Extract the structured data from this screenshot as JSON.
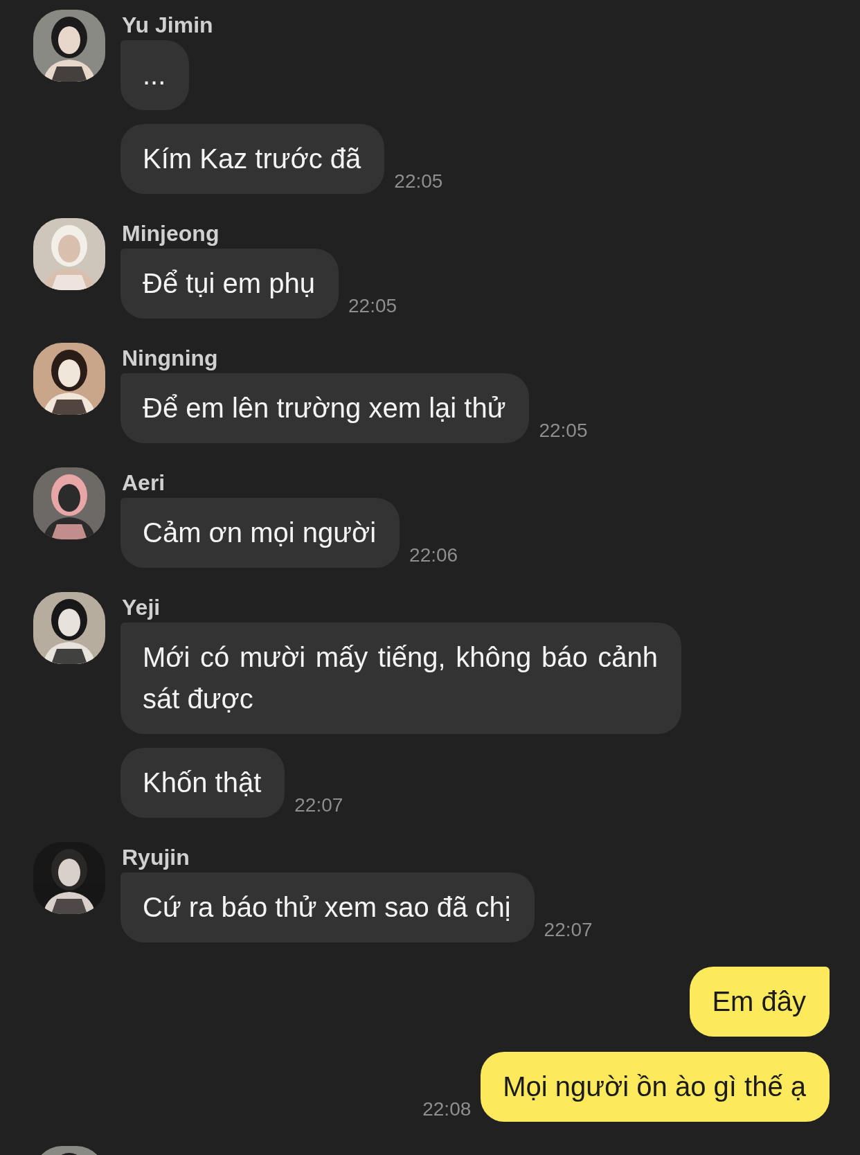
{
  "thread": [
    {
      "kind": "incoming",
      "avatar": {
        "kind": "picture"
      },
      "sender": "Yu Jimin",
      "messages": [
        {
          "text": "..."
        },
        {
          "text": "Kím Kaz trước đã",
          "time": "22:05"
        }
      ]
    },
    {
      "kind": "incoming",
      "avatar": {
        "kind": "picture"
      },
      "sender": "Minjeong",
      "messages": [
        {
          "text": "Để tụi em phụ",
          "time": "22:05"
        }
      ]
    },
    {
      "kind": "incoming",
      "avatar": {
        "kind": "picture"
      },
      "sender": "Ningning",
      "messages": [
        {
          "text": "Để em lên trường xem lại thử",
          "time": "22:05"
        }
      ]
    },
    {
      "kind": "incoming",
      "avatar": {
        "kind": "picture"
      },
      "sender": "Aeri",
      "messages": [
        {
          "text": "Cảm ơn mọi người",
          "time": "22:06"
        }
      ]
    },
    {
      "kind": "incoming",
      "avatar": {
        "kind": "picture"
      },
      "sender": "Yeji",
      "messages": [
        {
          "text": "Mới có mười mấy tiếng, không báo cảnh sát được"
        },
        {
          "text": "Khốn thật",
          "time": "22:07"
        }
      ]
    },
    {
      "kind": "incoming",
      "avatar": {
        "kind": "picture"
      },
      "sender": "Ryujin",
      "messages": [
        {
          "text": "Cứ ra báo thử xem sao đã chị",
          "time": "22:07"
        }
      ]
    },
    {
      "kind": "outgoing",
      "messages": [
        {
          "text": "Em đây"
        },
        {
          "text": "Mọi người ồn ào gì thế ạ",
          "time": "22:08"
        }
      ]
    },
    {
      "kind": "incoming",
      "avatar": {
        "kind": "picture"
      }
    }
  ]
}
